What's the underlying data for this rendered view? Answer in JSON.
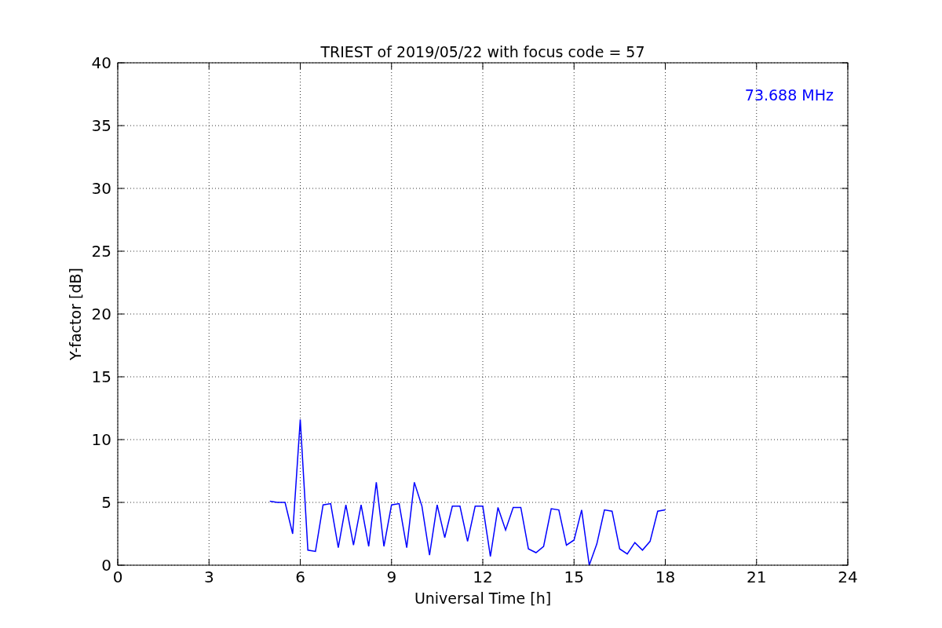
{
  "chart_data": {
    "type": "line",
    "title": "TRIEST of 2019/05/22 with focus code = 57",
    "xlabel": "Universal Time [h]",
    "ylabel": "Y-factor [dB]",
    "x": [
      5,
      5.25,
      5.5,
      5.75,
      6,
      6.25,
      6.5,
      6.75,
      7,
      7.25,
      7.5,
      7.75,
      8,
      8.25,
      8.5,
      8.75,
      9,
      9.25,
      9.5,
      9.75,
      10,
      10.25,
      10.5,
      10.75,
      11,
      11.25,
      11.5,
      11.75,
      12,
      12.25,
      12.5,
      12.75,
      13,
      13.25,
      13.5,
      13.75,
      14,
      14.25,
      14.5,
      14.75,
      15,
      15.25,
      15.5,
      15.75,
      16,
      16.25,
      16.5,
      16.75,
      17,
      17.25,
      17.5,
      17.75,
      18
    ],
    "series": [
      {
        "name": "73.688 MHz",
        "color": "#0000ff",
        "values": [
          5.1,
          5.0,
          5.0,
          2.5,
          11.6,
          1.2,
          1.1,
          4.8,
          4.9,
          1.4,
          4.8,
          1.6,
          4.8,
          1.5,
          6.6,
          1.5,
          4.8,
          4.9,
          1.4,
          6.6,
          4.7,
          0.8,
          4.8,
          2.2,
          4.7,
          4.7,
          1.9,
          4.7,
          4.7,
          0.7,
          4.6,
          2.8,
          4.6,
          4.6,
          1.3,
          1.0,
          1.5,
          4.5,
          4.4,
          1.6,
          2.0,
          4.4,
          0,
          1.7,
          4.4,
          4.3,
          1.3,
          0.9,
          1.8,
          1.2,
          1.9,
          4.3,
          4.4
        ]
      }
    ],
    "xlim": [
      0,
      24
    ],
    "ylim": [
      0,
      40
    ],
    "xticks": [
      0,
      3,
      6,
      9,
      12,
      15,
      18,
      21,
      24
    ],
    "yticks": [
      0,
      5,
      10,
      15,
      20,
      25,
      30,
      35,
      40
    ],
    "grid": true
  }
}
